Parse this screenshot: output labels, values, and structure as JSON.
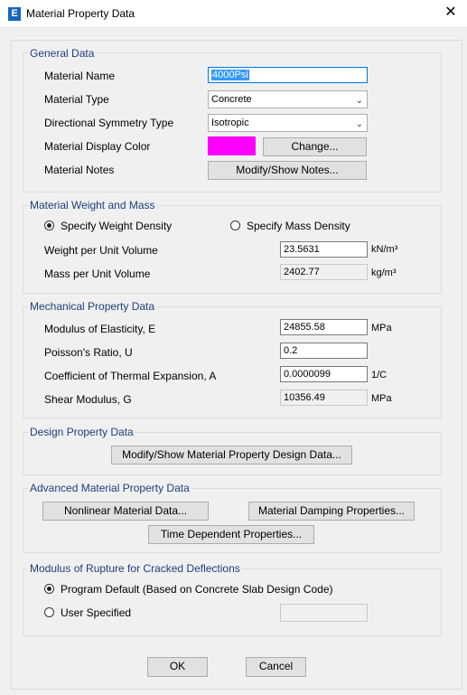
{
  "window": {
    "title": "Material Property Data",
    "app_icon_letter": "E",
    "close_glyph": "✕"
  },
  "general": {
    "heading": "General Data",
    "material_name_label": "Material Name",
    "material_name_value": "4000Psi",
    "material_type_label": "Material Type",
    "material_type_value": "Concrete",
    "symmetry_label": "Directional Symmetry Type",
    "symmetry_value": "Isotropic",
    "display_color_label": "Material Display Color",
    "display_color": "#ff00ff",
    "change_button": "Change...",
    "notes_label": "Material Notes",
    "notes_button": "Modify/Show Notes..."
  },
  "weight": {
    "heading": "Material Weight and Mass",
    "radio_weight": "Specify Weight Density",
    "radio_mass": "Specify Mass Density",
    "weight_label": "Weight per Unit Volume",
    "weight_value": "23.5631",
    "weight_unit": "kN/m³",
    "mass_label": "Mass per Unit Volume",
    "mass_value": "2402.77",
    "mass_unit": "kg/m³"
  },
  "mechanical": {
    "heading": "Mechanical Property Data",
    "modulus_label": "Modulus of Elasticity,  E",
    "modulus_value": "24855.58",
    "modulus_unit": "MPa",
    "poisson_label": "Poisson's Ratio,  U",
    "poisson_value": "0.2",
    "thermal_label": "Coefficient of Thermal Expansion,  A",
    "thermal_value": "0.0000099",
    "thermal_unit": "1/C",
    "shear_label": "Shear Modulus,  G",
    "shear_value": "10356.49",
    "shear_unit": "MPa"
  },
  "design": {
    "heading": "Design Property Data",
    "button": "Modify/Show Material Property Design Data..."
  },
  "advanced": {
    "heading": "Advanced Material Property Data",
    "nonlinear_button": "Nonlinear Material Data...",
    "damping_button": "Material Damping Properties...",
    "time_button": "Time Dependent Properties..."
  },
  "rupture": {
    "heading": "Modulus of Rupture for Cracked Deflections",
    "radio_default": "Program Default  (Based on Concrete Slab Design Code)",
    "radio_user": "User Specified"
  },
  "footer": {
    "ok": "OK",
    "cancel": "Cancel"
  }
}
